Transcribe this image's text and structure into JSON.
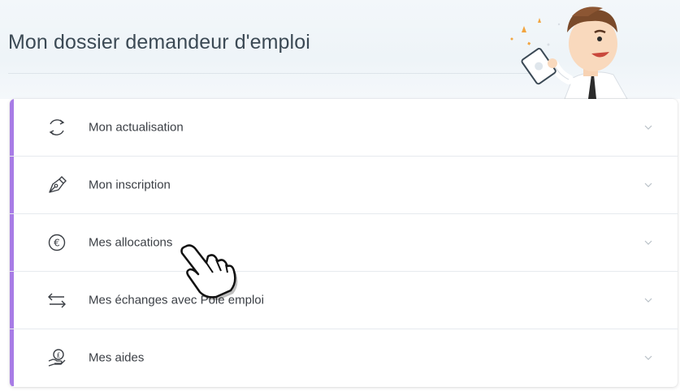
{
  "header": {
    "title": "Mon dossier demandeur d'emploi"
  },
  "accordion": {
    "accent_color": "#a87ce6",
    "items": [
      {
        "label": "Mon actualisation",
        "icon": "refresh-icon"
      },
      {
        "label": "Mon inscription",
        "icon": "pen-nib-icon"
      },
      {
        "label": "Mes allocations",
        "icon": "euro-icon"
      },
      {
        "label": "Mes échanges avec Pôle emploi",
        "icon": "swap-arrows-icon"
      },
      {
        "label": "Mes aides",
        "icon": "hand-coin-icon"
      }
    ]
  }
}
